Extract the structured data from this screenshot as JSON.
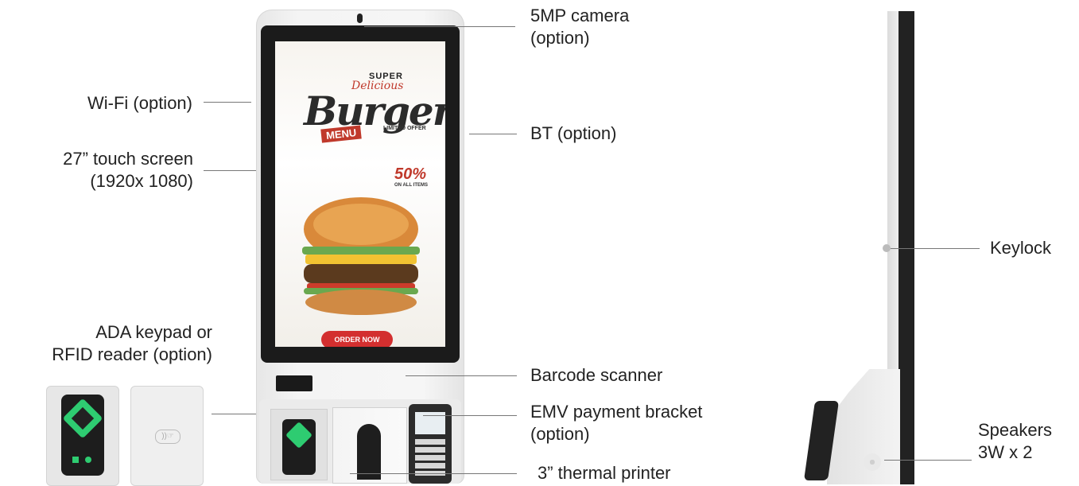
{
  "labels": {
    "wifi": "Wi-Fi (option)",
    "touch_screen_line1": "27” touch screen",
    "touch_screen_line2": "(1920x 1080)",
    "ada_line1": "ADA keypad or",
    "ada_line2": "RFID reader (option)",
    "camera_line1": "5MP camera",
    "camera_line2": "(option)",
    "bt": "BT (option)",
    "barcode": "Barcode scanner",
    "emv_line1": "EMV payment bracket",
    "emv_line2": "(option)",
    "printer": "3” thermal printer",
    "keylock": "Keylock",
    "speakers_line1": "Speakers",
    "speakers_line2": "3W x 2"
  },
  "screen_promo": {
    "super": "SUPER",
    "delicious": "Delicious",
    "burger": "Burger",
    "menu": "MENU",
    "limited": "LIMITED OFFER",
    "discount": "50%",
    "off": "OFF",
    "on_all_items": "ON ALL ITEMS",
    "order_button": "ORDER NOW"
  },
  "colors": {
    "accent": "#d32f2f",
    "keypad_green": "#2ecc71",
    "bezel": "#1b1b1b"
  }
}
